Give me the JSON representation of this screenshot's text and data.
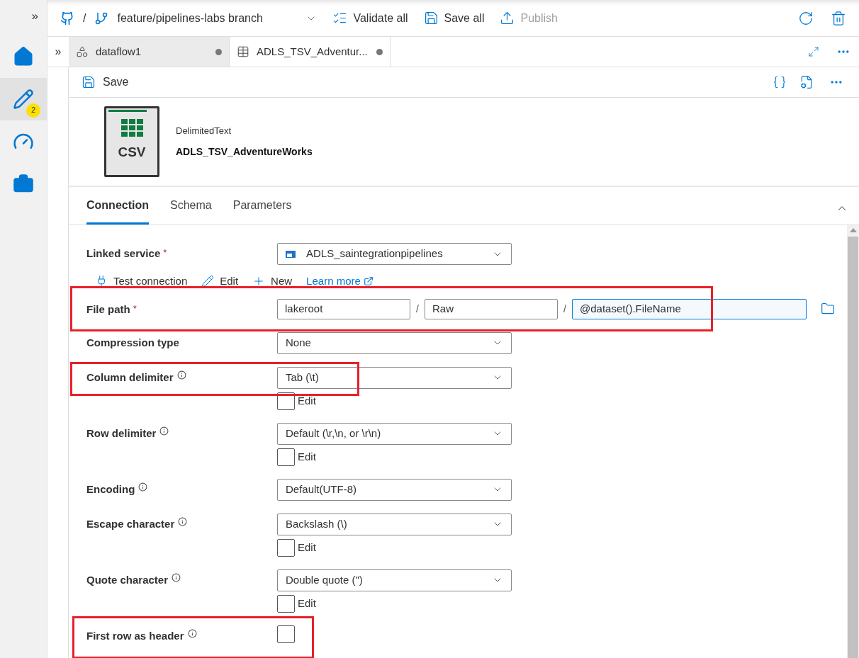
{
  "rail": {
    "expand": "»",
    "items": [
      {
        "selected": false
      },
      {
        "selected": true,
        "badge": "2"
      },
      {
        "selected": false
      },
      {
        "selected": false
      }
    ]
  },
  "topbar": {
    "separator": "/",
    "branch": "feature/pipelines-labs branch",
    "actions": [
      {
        "label": "Validate all",
        "disabled": false
      },
      {
        "label": "Save all",
        "disabled": false
      },
      {
        "label": "Publish",
        "disabled": true
      }
    ]
  },
  "doc_tabs": {
    "expand": "»",
    "tabs": [
      {
        "label": "dataflow1",
        "selected": false,
        "unsaved": true
      },
      {
        "label": "ADLS_TSV_Adventur...",
        "selected": true,
        "unsaved": true
      }
    ]
  },
  "toolbar": {
    "save": "Save"
  },
  "dataset": {
    "type": "DelimitedText",
    "name": "ADLS_TSV_AdventureWorks",
    "icon_text": "CSV"
  },
  "tabs": [
    {
      "label": "Connection",
      "selected": true
    },
    {
      "label": "Schema",
      "selected": false
    },
    {
      "label": "Parameters",
      "selected": false
    }
  ],
  "form": [
    {
      "kind": "dropdown",
      "label": "Linked service",
      "required_mark": "*",
      "info": false,
      "value": "ADLS_saintegrationpipelines",
      "highlighted": false
    },
    {
      "kind": "actions",
      "items": [
        {
          "label": "Test connection"
        },
        {
          "label": "Edit"
        },
        {
          "label": "New"
        }
      ],
      "link": "Learn more"
    },
    {
      "kind": "path",
      "label": "File path",
      "required_mark": "*",
      "info": false,
      "parts": [
        "lakeroot",
        "Raw",
        "@dataset().FileName"
      ],
      "separator": "/",
      "highlighted": true
    },
    {
      "kind": "dropdown",
      "label": "Compression type",
      "info": false,
      "value": "None",
      "highlighted": false
    },
    {
      "kind": "dropdown",
      "label": "Column delimiter",
      "info": true,
      "value": "Tab (\\t)",
      "edit": {
        "label": "Edit",
        "checked": false
      },
      "highlighted": true
    },
    {
      "kind": "dropdown",
      "label": "Row delimiter",
      "info": true,
      "value": "Default (\\r,\\n, or \\r\\n)",
      "edit": {
        "label": "Edit",
        "checked": false
      },
      "highlighted": false
    },
    {
      "kind": "dropdown",
      "label": "Encoding",
      "info": true,
      "value": "Default(UTF-8)",
      "highlighted": false
    },
    {
      "kind": "dropdown",
      "label": "Escape character",
      "info": true,
      "value": "Backslash (\\)",
      "edit": {
        "label": "Edit",
        "checked": false
      },
      "highlighted": false
    },
    {
      "kind": "dropdown",
      "label": "Quote character",
      "info": true,
      "value": "Double quote (\")",
      "edit": {
        "label": "Edit",
        "checked": false
      },
      "highlighted": false
    },
    {
      "kind": "checkbox",
      "label": "First row as header",
      "info": true,
      "checked": false,
      "highlighted": true
    }
  ]
}
